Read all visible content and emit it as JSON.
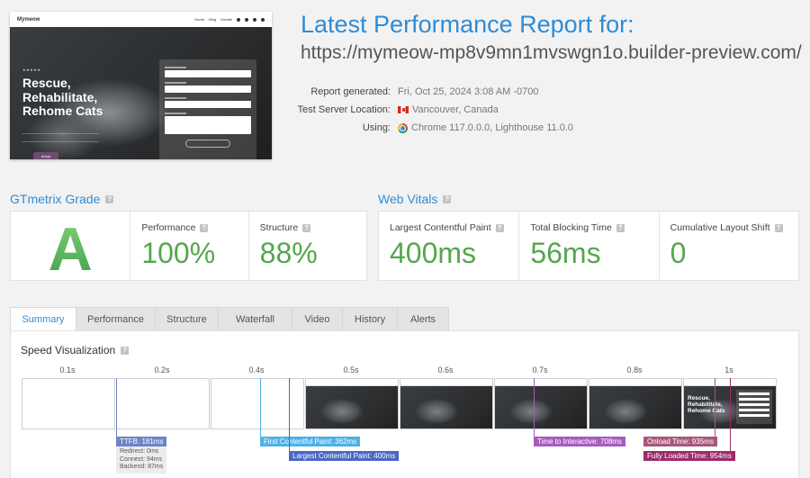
{
  "thumbnail": {
    "logo": "Mymeow",
    "nav": [
      "Home",
      "Blog",
      "Donate"
    ],
    "hero_title": [
      "Rescue,",
      "Rehabilitate,",
      "Rehome Cats"
    ],
    "stars": "★★★★★",
    "button": "Adopt"
  },
  "header": {
    "title": "Latest Performance Report for:",
    "url": "https://mymeow-mp8v9mn1mvswgn1o.builder-preview.com/",
    "meta": [
      {
        "key": "Report generated:",
        "value": "Fri, Oct 25, 2024 3:08 AM -0700"
      },
      {
        "key": "Test Server Location:",
        "value": "Vancouver, Canada"
      },
      {
        "key": "Using:",
        "value": "Chrome 117.0.0.0, Lighthouse 11.0.0"
      }
    ]
  },
  "gtmetrix": {
    "heading": "GTmetrix Grade",
    "grade": "A",
    "performance_label": "Performance",
    "performance_value": "100%",
    "structure_label": "Structure",
    "structure_value": "88%"
  },
  "web_vitals": {
    "heading": "Web Vitals",
    "lcp_label": "Largest Contentful Paint",
    "lcp_value": "400ms",
    "tbt_label": "Total Blocking Time",
    "tbt_value": "56ms",
    "cls_label": "Cumulative Layout Shift",
    "cls_value": "0"
  },
  "tabs": [
    "Summary",
    "Performance",
    "Structure",
    "Waterfall",
    "Video",
    "History",
    "Alerts"
  ],
  "speed": {
    "title": "Speed Visualization",
    "ticks": [
      "0.1s",
      "0.2s",
      "0.4s",
      "0.5s",
      "0.6s",
      "0.7s",
      "0.8s",
      "1s"
    ],
    "ttfb": "TTFB: 181ms",
    "ttfb_details": [
      "Redirect: 0ms",
      "Connect: 94ms",
      "Backend: 87ms"
    ],
    "fcp": "First Contentful Paint: 362ms",
    "lcp": "Largest Contentful Paint: 400ms",
    "tti": "Time to Interactive: 708ms",
    "onload": "Onload Time: 935ms",
    "fully_loaded": "Fully Loaded Time: 954ms",
    "final_frame_title": [
      "Rescue,",
      "Rehabilitate,",
      "Rehome Cats"
    ]
  },
  "colors": {
    "accent": "#2f8cd6",
    "good": "#55a64d",
    "ttfb": "#6b84c7",
    "fcp": "#4fb0e6",
    "lcp": "#4a68c4",
    "tti": "#a75bbf",
    "onload": "#a8577d",
    "fully_loaded": "#9b2c6c"
  }
}
